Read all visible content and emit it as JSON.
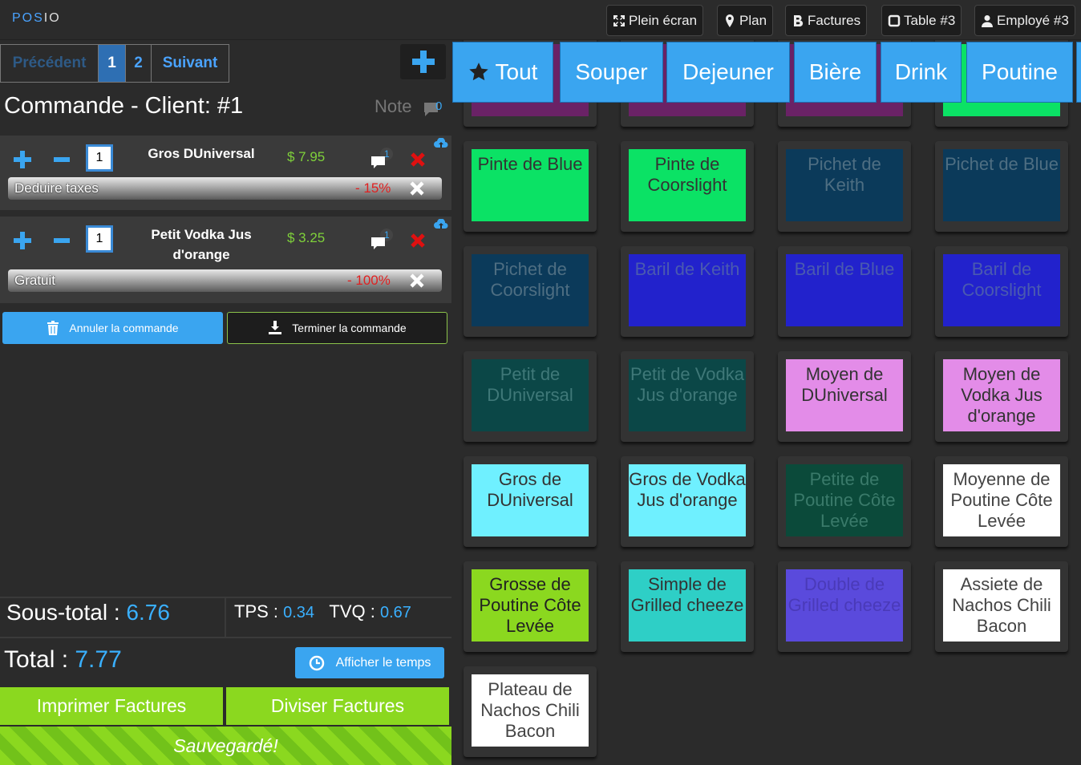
{
  "brand": {
    "left": "POS",
    "right": "IO"
  },
  "topnav": {
    "fullscreen": "Plein écran",
    "plan": "Plan",
    "invoices": "Factures",
    "table": "Table #3",
    "employee": "Employé #3"
  },
  "pager": {
    "prev": "Précédent",
    "page1": "1",
    "page2": "2",
    "next": "Suivant"
  },
  "order": {
    "title": "Commande - Client: #1",
    "note_label": "Note",
    "note_count": "0",
    "items": [
      {
        "qty": "1",
        "name": "Gros DUniversal",
        "price": "$ 7.95",
        "comment_count": "1",
        "modifier": "Deduire taxes",
        "discount": "- 15%"
      },
      {
        "qty": "1",
        "name": "Petit Vodka Jus d'orange",
        "price": "$ 3.25",
        "comment_count": "1",
        "modifier": "Gratuit",
        "discount": "- 100%"
      }
    ],
    "cancel_label": "Annuler la commande",
    "finish_label": "Terminer la commande"
  },
  "totals": {
    "subtotal_label": "Sous-total : ",
    "subtotal_value": "6.76",
    "tps_label": "TPS : ",
    "tps_value": "0.34",
    "tvq_label": "TVQ : ",
    "tvq_value": "0.67",
    "total_label": "Total : ",
    "total_value": "7.77",
    "time_label": "Afficher le temps"
  },
  "actions": {
    "print": "Imprimer Factures",
    "split": "Diviser Factures",
    "saved": "Sauvegardé!"
  },
  "categories": [
    "Tout",
    "Souper",
    "Dejeuner",
    "Bière",
    "Drink",
    "Poutine"
  ],
  "products": [
    {
      "label": "",
      "bg": "#6a2266",
      "fg": "#ffffff"
    },
    {
      "label": "",
      "bg": "#6a2266",
      "fg": "#ffffff"
    },
    {
      "label": "",
      "bg": "#6a2266",
      "fg": "#ffffff"
    },
    {
      "label": "",
      "bg": "#0be265",
      "fg": "#ffffff"
    },
    {
      "label": "Pinte de Blue",
      "bg": "#0be265",
      "fg": "#333333"
    },
    {
      "label": "Pinte de Coorslight",
      "bg": "#0be265",
      "fg": "#333333"
    },
    {
      "label": "Pichet de Keith",
      "bg": "#0b3a5a",
      "fg": "#4e6e82"
    },
    {
      "label": "Pichet de Blue",
      "bg": "#0b3a5a",
      "fg": "#4e6e82"
    },
    {
      "label": "Pichet de Coorslight",
      "bg": "#0b3a5a",
      "fg": "#4e6e82"
    },
    {
      "label": "Baril de Keith",
      "bg": "#2222cc",
      "fg": "#4a5ab0"
    },
    {
      "label": "Baril de Blue",
      "bg": "#2222cc",
      "fg": "#4a5ab0"
    },
    {
      "label": "Baril de Coorslight",
      "bg": "#2222cc",
      "fg": "#4a5ab0"
    },
    {
      "label": "Petit de DUniversal",
      "bg": "#0b4747",
      "fg": "#3f7878"
    },
    {
      "label": "Petit de Vodka Jus d'orange",
      "bg": "#0b4747",
      "fg": "#3f7878"
    },
    {
      "label": "Moyen de DUniversal",
      "bg": "#e38ce8",
      "fg": "#333333"
    },
    {
      "label": "Moyen de Vodka Jus d'orange",
      "bg": "#e38ce8",
      "fg": "#333333"
    },
    {
      "label": "Gros de DUniversal",
      "bg": "#6ff0ff",
      "fg": "#333333"
    },
    {
      "label": "Gros de Vodka Jus d'orange",
      "bg": "#6ff0ff",
      "fg": "#333333"
    },
    {
      "label": "Petite de Poutine Côte Levée",
      "bg": "#0b4a3a",
      "fg": "#3a7a6a"
    },
    {
      "label": "Moyenne de Poutine Côte Levée",
      "bg": "#ffffff",
      "fg": "#444444"
    },
    {
      "label": "Grosse de Poutine Côte Levée",
      "bg": "#8bd81f",
      "fg": "#222222"
    },
    {
      "label": "Simple de Grilled cheeze",
      "bg": "#2ecfc6",
      "fg": "#333333"
    },
    {
      "label": "Double de Grilled cheeze",
      "bg": "#5a4adc",
      "fg": "#4a3ab8"
    },
    {
      "label": "Assiete de Nachos Chili Bacon",
      "bg": "#ffffff",
      "fg": "#444444"
    },
    {
      "label": "Plateau de Nachos Chili Bacon",
      "bg": "#ffffff",
      "fg": "#444444"
    }
  ]
}
